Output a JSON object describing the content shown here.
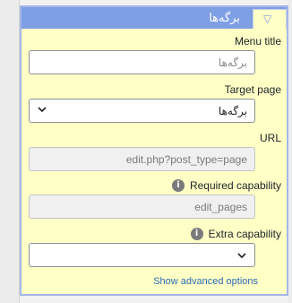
{
  "header": {
    "title": "برگه‌ها",
    "toggle_icon": "triangle-down-icon"
  },
  "menu_title": {
    "label": "Menu title",
    "placeholder": "برگه‌ها"
  },
  "target_page": {
    "label": "Target page",
    "value": "برگه‌ها"
  },
  "url": {
    "label": "URL",
    "value": "edit.php?post_type=page"
  },
  "required_capability": {
    "label": "Required capability",
    "value": "edit_pages",
    "info": "i"
  },
  "extra_capability": {
    "label": "Extra capability",
    "value": "",
    "info": "i"
  },
  "advanced_link": "Show advanced options"
}
